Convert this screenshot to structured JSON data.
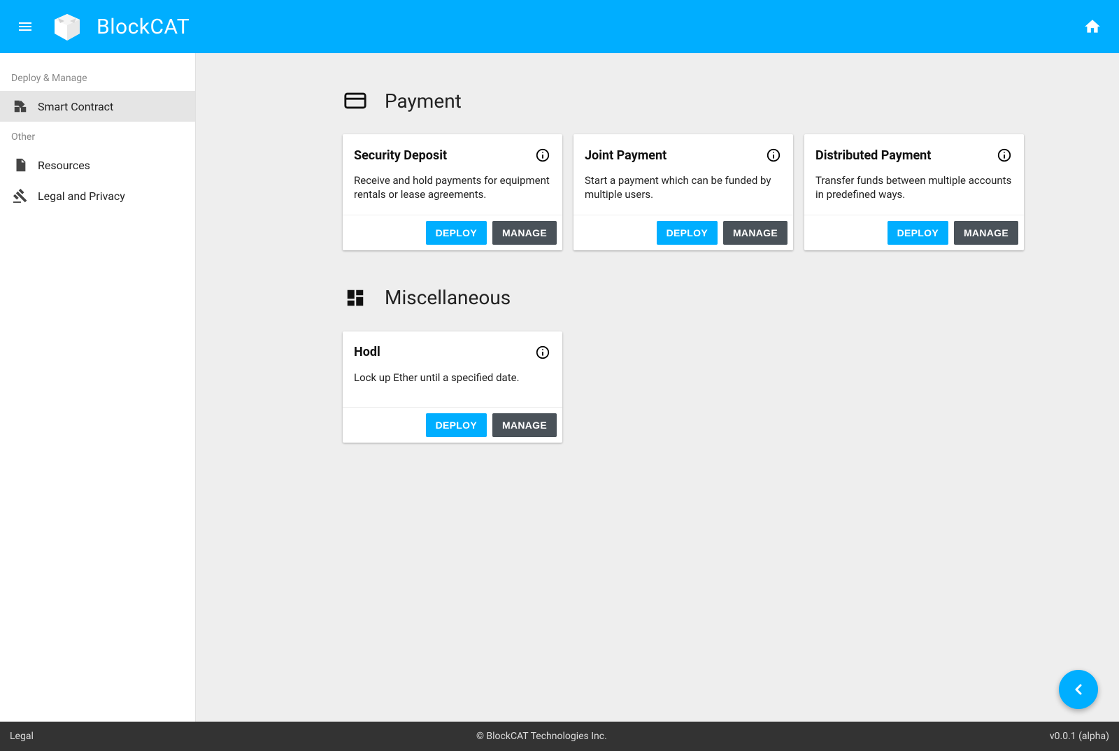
{
  "header": {
    "app_title": "BlockCAT"
  },
  "sidebar": {
    "groups": [
      {
        "label": "Deploy & Manage",
        "items": [
          {
            "label": "Smart Contract",
            "active": true
          }
        ]
      },
      {
        "label": "Other",
        "items": [
          {
            "label": "Resources",
            "active": false
          },
          {
            "label": "Legal and Privacy",
            "active": false
          }
        ]
      }
    ]
  },
  "sections": [
    {
      "title": "Payment",
      "cards": [
        {
          "title": "Security Deposit",
          "desc": "Receive and hold payments for equipment rentals or lease agreements.",
          "deploy_label": "DEPLOY",
          "manage_label": "MANAGE"
        },
        {
          "title": "Joint Payment",
          "desc": "Start a payment which can be funded by multiple users.",
          "deploy_label": "DEPLOY",
          "manage_label": "MANAGE"
        },
        {
          "title": "Distributed Payment",
          "desc": "Transfer funds between multiple accounts in predefined ways.",
          "deploy_label": "DEPLOY",
          "manage_label": "MANAGE"
        }
      ]
    },
    {
      "title": "Miscellaneous",
      "cards": [
        {
          "title": "Hodl",
          "desc": "Lock up Ether until a specified date.",
          "deploy_label": "DEPLOY",
          "manage_label": "MANAGE"
        }
      ]
    }
  ],
  "footer": {
    "left": "Legal",
    "center": "© BlockCAT Technologies Inc.",
    "right": "v0.0.1 (alpha)"
  }
}
